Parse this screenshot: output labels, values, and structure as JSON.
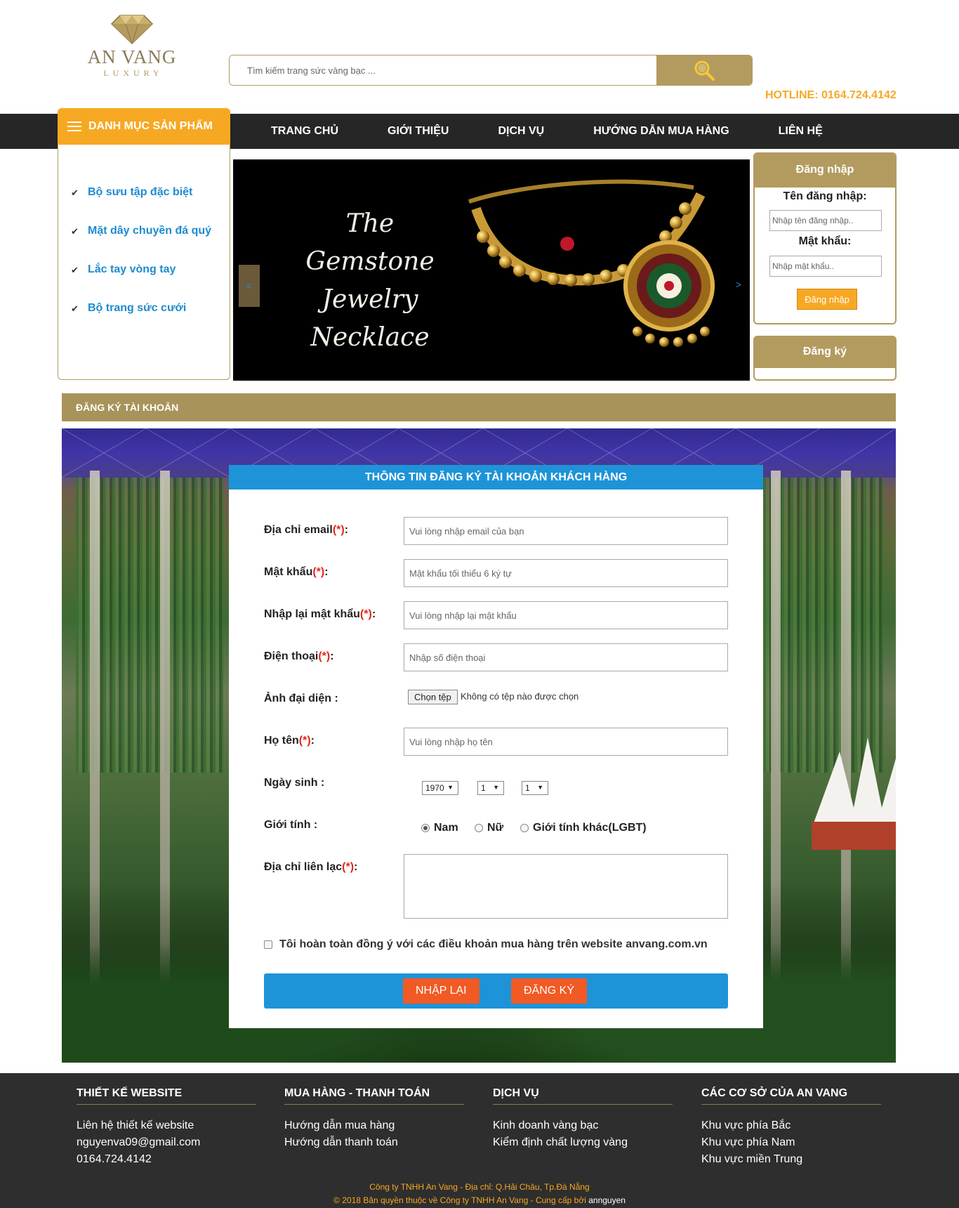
{
  "brand": {
    "name": "AN VANG",
    "tagline": "LUXURY",
    "gold": "#b39b60",
    "orange": "#f7a823",
    "blue": "#1e93d8"
  },
  "search": {
    "placeholder": "Tìm kiếm trang sức vàng bạc ...",
    "icon": "search-icon"
  },
  "hotline": "HOTLINE: 0164.724.4142",
  "nav": [
    "TRANG CHỦ",
    "GIỚI THIỆU",
    "DỊCH VỤ",
    "HƯỚNG DẪN MUA HÀNG",
    "LIÊN HỆ"
  ],
  "categories": {
    "title": "DANH MỤC SẢN PHẨM",
    "items": [
      "Bộ sưu tập đặc biệt",
      "Mặt dây chuyền đá quý",
      "Lắc tay vòng tay",
      "Bộ trang sức cưới"
    ]
  },
  "banner": {
    "line1": "The",
    "line2": "Gemstone Jewelry",
    "line3": "Necklace",
    "prev": "<",
    "next": ">"
  },
  "login": {
    "title": "Đăng nhập",
    "username_label": "Tên đăng nhập:",
    "username_placeholder": "Nhập tên đăng nhập..",
    "password_label": "Mật khẩu:",
    "password_placeholder": "Nhập mật khẩu..",
    "button": "Đăng nhập",
    "register": "Đăng ký"
  },
  "section_title": "ĐĂNG KÝ TÀI KHOẢN",
  "form": {
    "title": "THÔNG TIN ĐĂNG KÝ TÀI KHOẢN KHÁCH HÀNG",
    "required_mark": "(*)",
    "email_label": "Địa chỉ email",
    "email_placeholder": "Vui lòng nhập email của bạn",
    "password_label": "Mật khẩu",
    "password_placeholder": "Mật khẩu tối thiểu 6 ký tự",
    "repassword_label": "Nhập lại mật khẩu",
    "repassword_placeholder": "Vui lòng nhập lại mật khẩu",
    "phone_label": "Điện thoại",
    "phone_placeholder": "Nhập số điện thoại",
    "avatar_label": "Ảnh đại diện :",
    "file_button": "Chọn tệp",
    "file_status": "Không có tệp nào được chọn",
    "fullname_label": "Họ tên",
    "fullname_placeholder": "Vui lòng nhập họ tên",
    "birthday_label": "Ngày sinh :",
    "birth_year": "1970",
    "birth_month": "1",
    "birth_day": "1",
    "gender_label": "Giới tính :",
    "gender_options": [
      "Nam",
      "Nữ",
      "Giới tính khác(LGBT)"
    ],
    "gender_selected": "Nam",
    "address_label": "Địa chỉ liên lạc",
    "agree_text": "Tôi hoàn toàn đồng ý với các điều khoản mua hàng trên website anvang.com.vn",
    "reset_button": "NHẬP LẠI",
    "submit_button": "ĐĂNG KÝ",
    "colon": ":"
  },
  "footer": {
    "columns": [
      {
        "title": "THIẾT KẾ WEBSITE",
        "lines": [
          "Liên hệ thiết kế website",
          "nguyenva09@gmail.com",
          "0164.724.4142"
        ]
      },
      {
        "title": "MUA HÀNG - THANH TOÁN",
        "lines": [
          "Hướng dẫn mua hàng",
          "Hướng dẫn thanh toán"
        ]
      },
      {
        "title": "DỊCH VỤ",
        "lines": [
          "Kinh doanh vàng bạc",
          "Kiểm định chất lượng vàng"
        ]
      },
      {
        "title": "CÁC CƠ SỞ CỦA AN VANG",
        "lines": [
          "Khu vực phía Bắc",
          "Khu vực phía Nam",
          "Khu vực miền Trung"
        ]
      }
    ],
    "address": "Công ty TNHH An Vang - Địa chỉ: Q.Hải Châu, Tp.Đà Nẵng",
    "copyright": "© 2018 Bản quyền thuộc về Công ty TNHH An Vang - Cung cấp bởi",
    "provider": "annguyen"
  }
}
